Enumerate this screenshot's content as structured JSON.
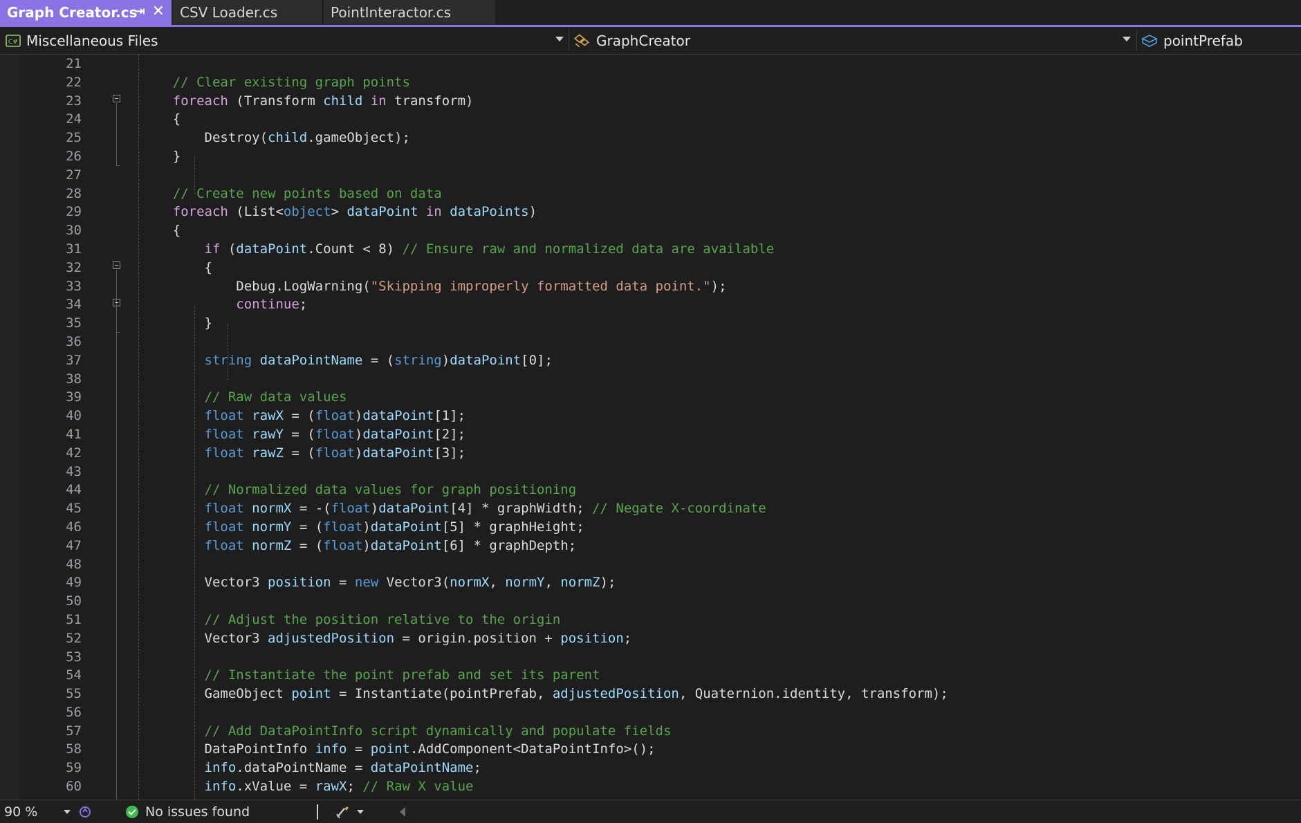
{
  "tabs": [
    {
      "label": "Graph Creator.cs",
      "active": true
    },
    {
      "label": "CSV Loader.cs",
      "active": false
    },
    {
      "label": "PointInteractor.cs",
      "active": false
    }
  ],
  "tab_icons": {
    "pin": "pin-icon",
    "close": "close-icon"
  },
  "nav": {
    "project": "Miscellaneous Files",
    "type": "GraphCreator",
    "member": "pointPrefab"
  },
  "colors": {
    "accent": "#8a74e3",
    "keyword": "#569cd6",
    "control": "#d8a0df",
    "comment": "#57a64a",
    "string": "#d69d85",
    "identifier": "#9cdcfe",
    "text": "#dcdcdc",
    "background": "#1e1e1e"
  },
  "editor": {
    "line_numbers": [
      "21",
      "22",
      "23",
      "24",
      "25",
      "26",
      "27",
      "28",
      "29",
      "30",
      "31",
      "32",
      "33",
      "34",
      "35",
      "36",
      "37",
      "38",
      "39",
      "40",
      "41",
      "42",
      "43",
      "44",
      "45",
      "46",
      "47",
      "48",
      "49",
      "50",
      "51",
      "52",
      "53",
      "54",
      "55",
      "56",
      "57",
      "58",
      "59",
      "60"
    ],
    "code_lines": [
      [],
      [
        {
          "t": "    // Clear existing graph points",
          "k": "cm"
        }
      ],
      [
        {
          "t": "    "
        },
        {
          "t": "foreach",
          "k": "ctrl"
        },
        {
          "t": " (Transform "
        },
        {
          "t": "child",
          "k": "var"
        },
        {
          "t": " "
        },
        {
          "t": "in",
          "k": "ctrl"
        },
        {
          "t": " transform)"
        }
      ],
      [
        {
          "t": "    {"
        }
      ],
      [
        {
          "t": "        Destroy("
        },
        {
          "t": "child",
          "k": "var"
        },
        {
          "t": ".gameObject);"
        }
      ],
      [
        {
          "t": "    }"
        }
      ],
      [],
      [
        {
          "t": "    // Create new points based on data",
          "k": "cm"
        }
      ],
      [
        {
          "t": "    "
        },
        {
          "t": "foreach",
          "k": "ctrl"
        },
        {
          "t": " (List<"
        },
        {
          "t": "object",
          "k": "kw"
        },
        {
          "t": "> "
        },
        {
          "t": "dataPoint",
          "k": "var"
        },
        {
          "t": " "
        },
        {
          "t": "in",
          "k": "ctrl"
        },
        {
          "t": " "
        },
        {
          "t": "dataPoints",
          "k": "var"
        },
        {
          "t": ")"
        }
      ],
      [
        {
          "t": "    {"
        }
      ],
      [
        {
          "t": "        "
        },
        {
          "t": "if",
          "k": "ctrl"
        },
        {
          "t": " ("
        },
        {
          "t": "dataPoint",
          "k": "var"
        },
        {
          "t": ".Count < 8) "
        },
        {
          "t": "// Ensure raw and normalized data are available",
          "k": "cm"
        }
      ],
      [
        {
          "t": "        {"
        }
      ],
      [
        {
          "t": "            Debug.LogWarning("
        },
        {
          "t": "\"Skipping improperly formatted data point.\"",
          "k": "str"
        },
        {
          "t": ");"
        }
      ],
      [
        {
          "t": "            "
        },
        {
          "t": "continue",
          "k": "ctrl"
        },
        {
          "t": ";"
        }
      ],
      [
        {
          "t": "        }"
        }
      ],
      [],
      [
        {
          "t": "        "
        },
        {
          "t": "string",
          "k": "kw"
        },
        {
          "t": " "
        },
        {
          "t": "dataPointName",
          "k": "var"
        },
        {
          "t": " = ("
        },
        {
          "t": "string",
          "k": "kw"
        },
        {
          "t": ")"
        },
        {
          "t": "dataPoint",
          "k": "var"
        },
        {
          "t": "[0];"
        }
      ],
      [],
      [
        {
          "t": "        // Raw data values",
          "k": "cm"
        }
      ],
      [
        {
          "t": "        "
        },
        {
          "t": "float",
          "k": "kw"
        },
        {
          "t": " "
        },
        {
          "t": "rawX",
          "k": "var"
        },
        {
          "t": " = ("
        },
        {
          "t": "float",
          "k": "kw"
        },
        {
          "t": ")"
        },
        {
          "t": "dataPoint",
          "k": "var"
        },
        {
          "t": "[1];"
        }
      ],
      [
        {
          "t": "        "
        },
        {
          "t": "float",
          "k": "kw"
        },
        {
          "t": " "
        },
        {
          "t": "rawY",
          "k": "var"
        },
        {
          "t": " = ("
        },
        {
          "t": "float",
          "k": "kw"
        },
        {
          "t": ")"
        },
        {
          "t": "dataPoint",
          "k": "var"
        },
        {
          "t": "[2];"
        }
      ],
      [
        {
          "t": "        "
        },
        {
          "t": "float",
          "k": "kw"
        },
        {
          "t": " "
        },
        {
          "t": "rawZ",
          "k": "var"
        },
        {
          "t": " = ("
        },
        {
          "t": "float",
          "k": "kw"
        },
        {
          "t": ")"
        },
        {
          "t": "dataPoint",
          "k": "var"
        },
        {
          "t": "[3];"
        }
      ],
      [],
      [
        {
          "t": "        // Normalized data values for graph positioning",
          "k": "cm"
        }
      ],
      [
        {
          "t": "        "
        },
        {
          "t": "float",
          "k": "kw"
        },
        {
          "t": " "
        },
        {
          "t": "normX",
          "k": "var"
        },
        {
          "t": " = -("
        },
        {
          "t": "float",
          "k": "kw"
        },
        {
          "t": ")"
        },
        {
          "t": "dataPoint",
          "k": "var"
        },
        {
          "t": "[4] * graphWidth; "
        },
        {
          "t": "// Negate X-coordinate",
          "k": "cm"
        }
      ],
      [
        {
          "t": "        "
        },
        {
          "t": "float",
          "k": "kw"
        },
        {
          "t": " "
        },
        {
          "t": "normY",
          "k": "var"
        },
        {
          "t": " = ("
        },
        {
          "t": "float",
          "k": "kw"
        },
        {
          "t": ")"
        },
        {
          "t": "dataPoint",
          "k": "var"
        },
        {
          "t": "[5] * graphHeight;"
        }
      ],
      [
        {
          "t": "        "
        },
        {
          "t": "float",
          "k": "kw"
        },
        {
          "t": " "
        },
        {
          "t": "normZ",
          "k": "var"
        },
        {
          "t": " = ("
        },
        {
          "t": "float",
          "k": "kw"
        },
        {
          "t": ")"
        },
        {
          "t": "dataPoint",
          "k": "var"
        },
        {
          "t": "[6] * graphDepth;"
        }
      ],
      [],
      [
        {
          "t": "        Vector3 "
        },
        {
          "t": "position",
          "k": "var"
        },
        {
          "t": " = "
        },
        {
          "t": "new",
          "k": "kw"
        },
        {
          "t": " Vector3("
        },
        {
          "t": "normX",
          "k": "var"
        },
        {
          "t": ", "
        },
        {
          "t": "normY",
          "k": "var"
        },
        {
          "t": ", "
        },
        {
          "t": "normZ",
          "k": "var"
        },
        {
          "t": ");"
        }
      ],
      [],
      [
        {
          "t": "        // Adjust the position relative to the origin",
          "k": "cm"
        }
      ],
      [
        {
          "t": "        Vector3 "
        },
        {
          "t": "adjustedPosition",
          "k": "var"
        },
        {
          "t": " = origin.position + "
        },
        {
          "t": "position",
          "k": "var"
        },
        {
          "t": ";"
        }
      ],
      [],
      [
        {
          "t": "        // Instantiate the point prefab and set its parent",
          "k": "cm"
        }
      ],
      [
        {
          "t": "        GameObject "
        },
        {
          "t": "point",
          "k": "var"
        },
        {
          "t": " = Instantiate(pointPrefab, "
        },
        {
          "t": "adjustedPosition",
          "k": "var"
        },
        {
          "t": ", Quaternion.identity, transform);"
        }
      ],
      [],
      [
        {
          "t": "        // Add DataPointInfo script dynamically and populate fields",
          "k": "cm"
        }
      ],
      [
        {
          "t": "        DataPointInfo "
        },
        {
          "t": "info",
          "k": "var"
        },
        {
          "t": " = "
        },
        {
          "t": "point",
          "k": "var"
        },
        {
          "t": ".AddComponent<DataPointInfo>();"
        }
      ],
      [
        {
          "t": "        "
        },
        {
          "t": "info",
          "k": "var"
        },
        {
          "t": ".dataPointName = "
        },
        {
          "t": "dataPointName",
          "k": "var"
        },
        {
          "t": ";"
        }
      ],
      [
        {
          "t": "        "
        },
        {
          "t": "info",
          "k": "var"
        },
        {
          "t": ".xValue = "
        },
        {
          "t": "rawX",
          "k": "var"
        },
        {
          "t": "; "
        },
        {
          "t": "// Raw X value",
          "k": "cm"
        }
      ]
    ]
  },
  "status": {
    "zoom": "90 %",
    "issues": "No issues found",
    "icons": {
      "health": "ok-check-icon",
      "brush": "code-cleanup-icon",
      "assistant": "intellicode-icon"
    }
  }
}
